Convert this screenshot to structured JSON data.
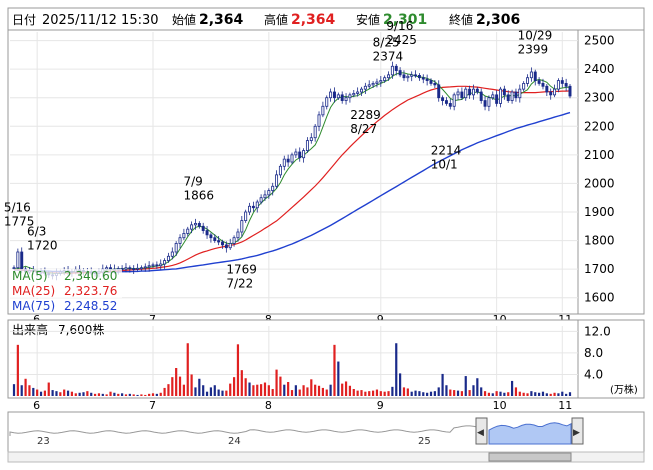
{
  "header": {
    "date_label": "日付",
    "datetime": "2025/11/12 15:30",
    "open_label": "始値",
    "open": "2,364",
    "high_label": "高値",
    "high": "2,364",
    "low_label": "安値",
    "low": "2,301",
    "close_label": "終値",
    "close": "2,306"
  },
  "colors": {
    "ma5": "#2e8b2e",
    "ma25": "#e02020",
    "ma75": "#2040d0",
    "candle": "#1a2a8a",
    "volume_up": "#e02020",
    "volume_down": "#1a2a8a",
    "navigator_fill": "#8fb0f0"
  },
  "chart_data": [
    {
      "type": "candlestick",
      "x_ticks": [
        "6",
        "7",
        "8",
        "9",
        "10",
        "11"
      ],
      "y_ticks": [
        "2500",
        "2400",
        "2300",
        "2200",
        "2100",
        "2000",
        "1900",
        "1800",
        "1700",
        "1600"
      ],
      "ylim": [
        1550,
        2530
      ],
      "legend": [
        {
          "label": "MA(5)",
          "value": "2,340.60",
          "color": "#2e8b2e"
        },
        {
          "label": "MA(25)",
          "value": "2,323.76",
          "color": "#e02020"
        },
        {
          "label": "MA(75)",
          "value": "2,248.52",
          "color": "#2040d0"
        }
      ],
      "annotations": [
        {
          "date": "5/16",
          "value": "1775"
        },
        {
          "date": "6/3",
          "value": "1720"
        },
        {
          "date": "7/9",
          "value": "1866"
        },
        {
          "date": "7/22",
          "value": "1769"
        },
        {
          "date": "8/25",
          "value": "2374"
        },
        {
          "date": "8/27",
          "value": "2289"
        },
        {
          "date": "9/16",
          "value": "2425"
        },
        {
          "date": "10/1",
          "value": "2214"
        },
        {
          "date": "10/29",
          "value": "2399"
        }
      ],
      "close_series": [
        1705,
        1760,
        1700,
        1690,
        1695,
        1692,
        1688,
        1690,
        1685,
        1680,
        1678,
        1685,
        1690,
        1695,
        1692,
        1690,
        1698,
        1695,
        1692,
        1690,
        1688,
        1685,
        1690,
        1700,
        1705,
        1700,
        1698,
        1702,
        1700,
        1705,
        1702,
        1700,
        1703,
        1705,
        1708,
        1712,
        1715,
        1712,
        1718,
        1730,
        1745,
        1760,
        1790,
        1810,
        1825,
        1840,
        1855,
        1860,
        1850,
        1835,
        1820,
        1810,
        1800,
        1795,
        1785,
        1775,
        1790,
        1810,
        1830,
        1870,
        1900,
        1920,
        1915,
        1935,
        1950,
        1960,
        1975,
        1990,
        2030,
        2060,
        2085,
        2075,
        2100,
        2110,
        2090,
        2115,
        2150,
        2160,
        2200,
        2240,
        2270,
        2300,
        2320,
        2300,
        2310,
        2290,
        2300,
        2310,
        2315,
        2320,
        2330,
        2340,
        2345,
        2350,
        2355,
        2360,
        2370,
        2380,
        2410,
        2395,
        2380,
        2370,
        2375,
        2380,
        2378,
        2370,
        2365,
        2360,
        2350,
        2345,
        2300,
        2290,
        2280,
        2270,
        2310,
        2320,
        2300,
        2330,
        2310,
        2330,
        2320,
        2290,
        2270,
        2300,
        2310,
        2280,
        2330,
        2310,
        2290,
        2320,
        2300,
        2330,
        2350,
        2370,
        2390,
        2360,
        2350,
        2340,
        2320,
        2310,
        2330,
        2360,
        2350,
        2340,
        2306
      ],
      "ma5_series": [
        1700,
        1702,
        1705,
        1710,
        1705,
        1700,
        1695,
        1692,
        1690,
        1688,
        1685,
        1684,
        1685,
        1687,
        1689,
        1690,
        1692,
        1693,
        1692,
        1691,
        1690,
        1689,
        1690,
        1693,
        1696,
        1698,
        1700,
        1701,
        1701,
        1702,
        1702,
        1702,
        1702,
        1703,
        1704,
        1706,
        1709,
        1711,
        1713,
        1718,
        1726,
        1737,
        1750,
        1771,
        1792,
        1814,
        1832,
        1846,
        1850,
        1847,
        1840,
        1830,
        1819,
        1808,
        1798,
        1791,
        1789,
        1792,
        1800,
        1813,
        1838,
        1870,
        1898,
        1918,
        1931,
        1945,
        1955,
        1968,
        1983,
        2003,
        2030,
        2050,
        2067,
        2082,
        2090,
        2098,
        2110,
        2122,
        2135,
        2162,
        2198,
        2234,
        2266,
        2286,
        2298,
        2304,
        2304,
        2302,
        2305,
        2307,
        2315,
        2323,
        2331,
        2338,
        2344,
        2350,
        2356,
        2363,
        2375,
        2383,
        2387,
        2387,
        2383,
        2381,
        2376,
        2373,
        2371,
        2368,
        2362,
        2356,
        2343,
        2329,
        2314,
        2298,
        2290,
        2292,
        2294,
        2306,
        2314,
        2318,
        2320,
        2316,
        2306,
        2302,
        2298,
        2292,
        2298,
        2306,
        2306,
        2308,
        2306,
        2312,
        2320,
        2328,
        2348,
        2360,
        2364,
        2360,
        2354,
        2340,
        2330,
        2332,
        2334,
        2336,
        2337
      ],
      "ma25_series": [
        1698,
        1698,
        1697,
        1696,
        1695,
        1693,
        1692,
        1690,
        1689,
        1688,
        1687,
        1686,
        1686,
        1686,
        1686,
        1686,
        1687,
        1687,
        1688,
        1688,
        1688,
        1689,
        1689,
        1690,
        1691,
        1692,
        1693,
        1694,
        1695,
        1696,
        1697,
        1698,
        1699,
        1700,
        1701,
        1702,
        1703,
        1704,
        1706,
        1708,
        1710,
        1713,
        1717,
        1722,
        1728,
        1735,
        1742,
        1749,
        1755,
        1760,
        1764,
        1768,
        1772,
        1775,
        1778,
        1780,
        1783,
        1786,
        1790,
        1795,
        1802,
        1810,
        1818,
        1826,
        1834,
        1843,
        1851,
        1860,
        1869,
        1880,
        1892,
        1904,
        1916,
        1928,
        1940,
        1952,
        1965,
        1978,
        1991,
        2005,
        2020,
        2036,
        2052,
        2068,
        2084,
        2100,
        2114,
        2128,
        2141,
        2154,
        2167,
        2180,
        2192,
        2204,
        2216,
        2227,
        2238,
        2248,
        2258,
        2267,
        2276,
        2284,
        2292,
        2298,
        2304,
        2310,
        2316,
        2322,
        2327,
        2331,
        2334,
        2336,
        2337,
        2338,
        2339,
        2340,
        2340,
        2340,
        2339,
        2338,
        2337,
        2335,
        2333,
        2331,
        2329,
        2327,
        2325,
        2323,
        2321,
        2320,
        2319,
        2318,
        2318,
        2318,
        2318,
        2318,
        2319,
        2320,
        2321,
        2321,
        2322,
        2322,
        2323,
        2323,
        2324
      ],
      "ma75_series": [
        1697,
        1697,
        1696,
        1696,
        1695,
        1695,
        1694,
        1694,
        1693,
        1693,
        1692,
        1692,
        1692,
        1691,
        1691,
        1691,
        1691,
        1690,
        1690,
        1690,
        1690,
        1690,
        1690,
        1690,
        1690,
        1690,
        1690,
        1690,
        1691,
        1691,
        1691,
        1692,
        1692,
        1693,
        1693,
        1694,
        1695,
        1696,
        1697,
        1698,
        1699,
        1700,
        1701,
        1703,
        1705,
        1707,
        1709,
        1711,
        1713,
        1715,
        1717,
        1719,
        1721,
        1723,
        1725,
        1727,
        1729,
        1731,
        1733,
        1736,
        1739,
        1742,
        1745,
        1748,
        1752,
        1756,
        1760,
        1764,
        1768,
        1773,
        1778,
        1783,
        1788,
        1794,
        1800,
        1806,
        1812,
        1818,
        1825,
        1832,
        1839,
        1846,
        1853,
        1861,
        1869,
        1877,
        1885,
        1893,
        1901,
        1909,
        1917,
        1925,
        1933,
        1941,
        1949,
        1957,
        1965,
        1973,
        1981,
        1989,
        1997,
        2005,
        2013,
        2021,
        2029,
        2037,
        2045,
        2053,
        2061,
        2069,
        2076,
        2083,
        2090,
        2097,
        2104,
        2111,
        2118,
        2124,
        2130,
        2136,
        2142,
        2147,
        2152,
        2157,
        2162,
        2167,
        2172,
        2177,
        2182,
        2187,
        2192,
        2196,
        2200,
        2204,
        2208,
        2212,
        2216,
        2220,
        2224,
        2228,
        2232,
        2236,
        2240,
        2244,
        2248
      ]
    },
    {
      "type": "bar",
      "title": "出来高",
      "last_value": "7,600株",
      "y_ticks": [
        "12.0",
        "8.0",
        "4.0"
      ],
      "unit": "(万株)",
      "ylim": [
        0,
        13
      ],
      "x_ticks": [
        "6",
        "7",
        "8",
        "9",
        "10",
        "11"
      ],
      "values": [
        2.2,
        9.5,
        2.0,
        3.2,
        2.0,
        1.5,
        1.2,
        0.8,
        1.0,
        2.5,
        1.1,
        0.9,
        0.7,
        1.2,
        1.0,
        0.8,
        0.5,
        0.6,
        0.7,
        0.9,
        0.6,
        0.4,
        0.5,
        0.4,
        0.3,
        0.8,
        0.6,
        0.4,
        0.5,
        0.3,
        0.4,
        0.3,
        0.2,
        0.3,
        0.2,
        0.4,
        0.5,
        0.4,
        0.6,
        1.5,
        2.2,
        3.5,
        5.2,
        3.6,
        2.1,
        9.8,
        4.0,
        1.6,
        3.2,
        2.0,
        0.8,
        1.6,
        2.0,
        1.2,
        1.0,
        1.0,
        2.3,
        3.5,
        9.6,
        4.8,
        3.3,
        2.5,
        2.0,
        2.1,
        2.2,
        2.5,
        2.0,
        1.3,
        4.9,
        3.6,
        2.1,
        2.6,
        1.1,
        2.0,
        1.2,
        2.0,
        1.6,
        3.1,
        2.1,
        1.9,
        1.5,
        1.2,
        2.1,
        9.5,
        6.4,
        2.3,
        2.7,
        1.9,
        1.3,
        1.0,
        1.1,
        0.8,
        0.9,
        1.0,
        1.2,
        0.9,
        0.8,
        0.9,
        1.7,
        9.8,
        4.2,
        1.6,
        1.4,
        0.8,
        1.0,
        0.9,
        0.7,
        0.6,
        0.8,
        0.9,
        1.6,
        4.1,
        2.0,
        1.2,
        1.1,
        1.0,
        0.9,
        3.7,
        1.1,
        2.0,
        3.3,
        1.6,
        0.9,
        0.6,
        0.5,
        0.9,
        0.8,
        0.6,
        0.7,
        2.8,
        1.6,
        0.8,
        0.6,
        0.5,
        0.9,
        0.7,
        0.6,
        0.8,
        0.5,
        0.4,
        0.6,
        0.5,
        0.8,
        0.4,
        0.7
      ],
      "up": [
        0,
        1,
        0,
        1,
        1,
        0,
        1,
        0,
        1,
        1,
        0,
        0,
        1,
        1,
        0,
        1,
        1,
        0,
        0,
        1,
        0,
        1,
        1,
        0,
        1,
        1,
        0,
        1,
        0,
        1,
        0,
        1,
        0,
        1,
        1,
        1,
        1,
        0,
        1,
        1,
        1,
        1,
        1,
        1,
        1,
        1,
        1,
        0,
        0,
        0,
        0,
        0,
        0,
        0,
        0,
        1,
        1,
        1,
        1,
        1,
        1,
        0,
        1,
        1,
        1,
        1,
        1,
        1,
        1,
        1,
        0,
        1,
        1,
        0,
        1,
        1,
        1,
        1,
        1,
        1,
        1,
        1,
        0,
        1,
        0,
        1,
        1,
        1,
        1,
        1,
        1,
        1,
        1,
        1,
        1,
        1,
        1,
        1,
        0,
        0,
        0,
        1,
        1,
        0,
        0,
        0,
        0,
        0,
        0,
        0,
        0,
        0,
        0,
        1,
        1,
        0,
        1,
        0,
        1,
        0,
        0,
        0,
        1,
        1,
        0,
        1,
        0,
        0,
        1,
        0,
        1,
        1,
        1,
        1,
        0,
        0,
        0,
        0,
        0,
        1,
        1,
        0,
        0,
        0
      ]
    }
  ],
  "navigator": {
    "labels": [
      "23",
      "24",
      "25"
    ],
    "left_handle": "◀",
    "right_handle": "▶"
  }
}
